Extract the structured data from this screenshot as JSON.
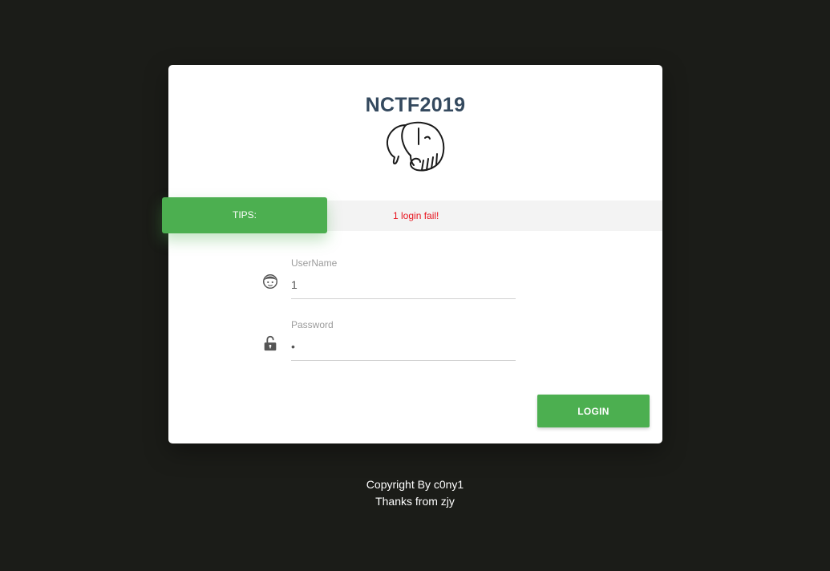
{
  "login_card": {
    "title": "NCTF2019",
    "logo_icon": "elephant-icon"
  },
  "tips": {
    "label": "TIPS:",
    "message": "1 login fail!",
    "label_color": "#4caf50",
    "message_color": "#e8151f"
  },
  "form": {
    "username": {
      "label": "UserName",
      "value": "1",
      "icon": "face-icon"
    },
    "password": {
      "label": "Password",
      "value": "1",
      "icon": "unlock-icon"
    },
    "login_button": {
      "label": "LOGIN",
      "color": "#4caf50"
    }
  },
  "footer": {
    "copyright": "Copyright By c0ny1",
    "thanks": "Thanks from zjy"
  }
}
